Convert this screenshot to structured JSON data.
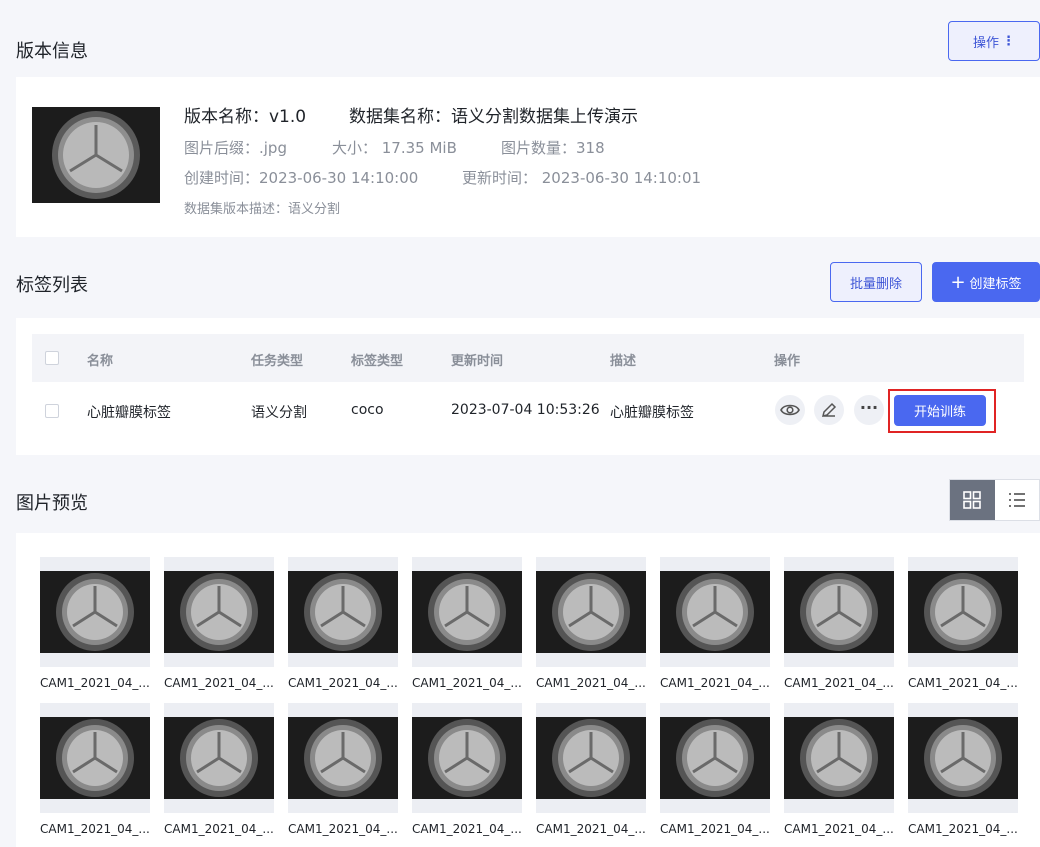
{
  "version_section": {
    "title": "版本信息",
    "ops_button": "操作",
    "version_name": "版本名称：v1.0",
    "dataset_name": "数据集名称：语义分割数据集上传演示",
    "suffix": "图片后缀：.jpg",
    "size": "大小：  17.35 MiB",
    "count": "图片数量：318",
    "created": "创建时间：2023-06-30 14:10:00",
    "updated": "更新时间：  2023-06-30 14:10:01",
    "description": "数据集版本描述：语义分割"
  },
  "label_section": {
    "title": "标签列表",
    "batch_delete": "批量删除",
    "create_label": "创建标签",
    "columns": [
      "名称",
      "任务类型",
      "标签类型",
      "更新时间",
      "描述",
      "操作"
    ],
    "rows": [
      {
        "name": "心脏瓣膜标签",
        "task_type": "语义分割",
        "label_type": "coco",
        "updated": "2023-07-04 10:53:26",
        "description": "心脏瓣膜标签",
        "train_button": "开始训练"
      }
    ]
  },
  "preview_section": {
    "title": "图片预览",
    "images": [
      "CAM1_2021_04_...",
      "CAM1_2021_04_...",
      "CAM1_2021_04_...",
      "CAM1_2021_04_...",
      "CAM1_2021_04_...",
      "CAM1_2021_04_...",
      "CAM1_2021_04_...",
      "CAM1_2021_04_...",
      "CAM1_2021_04_...",
      "CAM1_2021_04_...",
      "CAM1_2021_04_...",
      "CAM1_2021_04_...",
      "CAM1_2021_04_...",
      "CAM1_2021_04_...",
      "CAM1_2021_04_...",
      "CAM1_2021_04_..."
    ]
  },
  "colors": {
    "primary": "#4a68f0",
    "highlight": "#e02424",
    "background": "#f5f6fa"
  }
}
